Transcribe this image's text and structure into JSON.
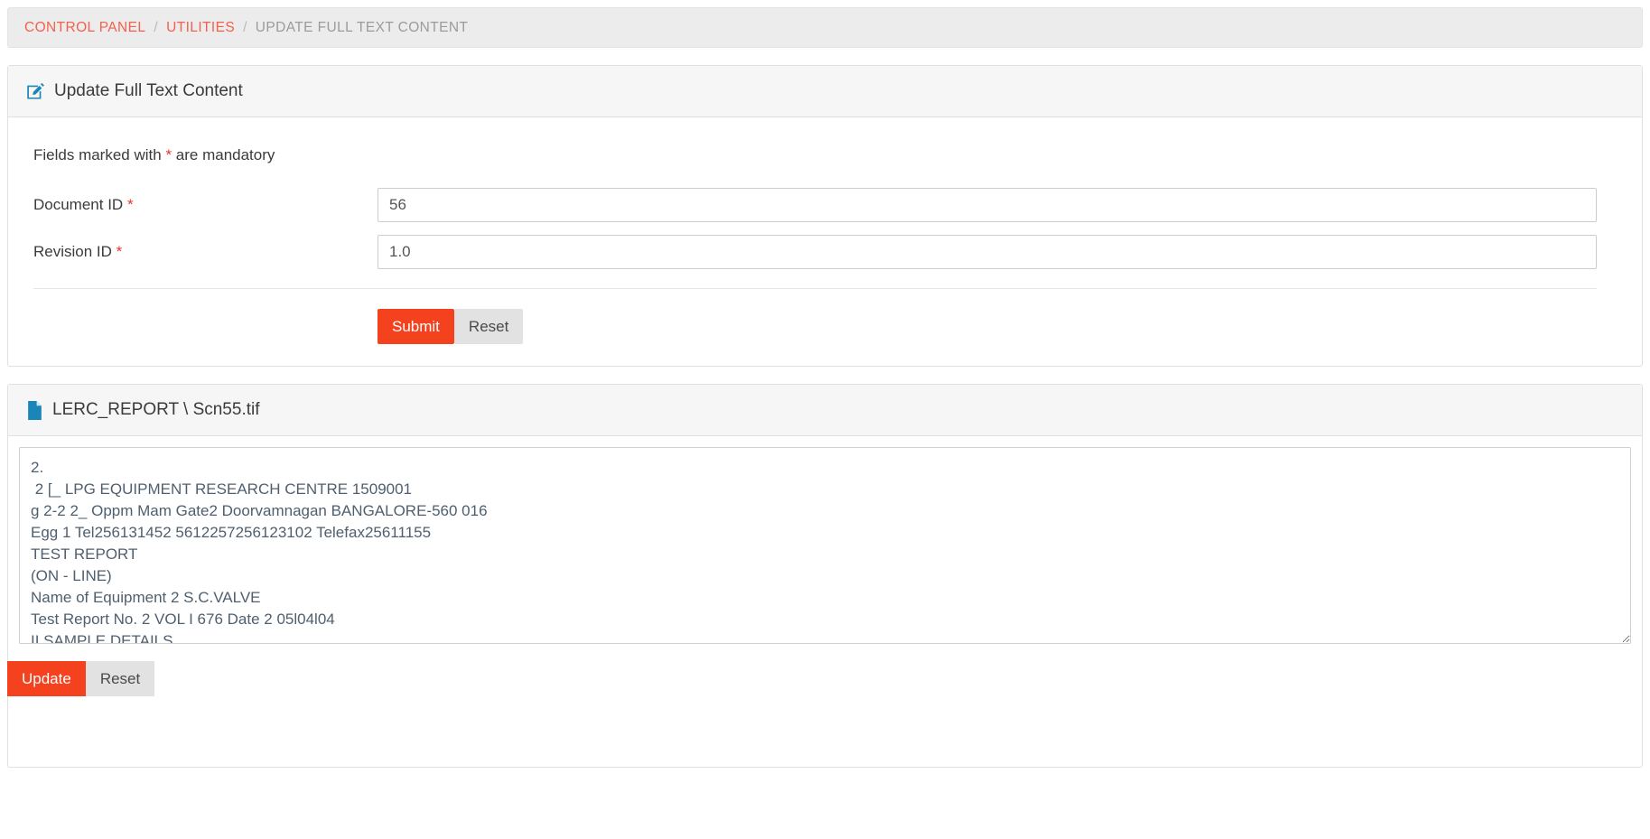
{
  "breadcrumb": {
    "items": [
      {
        "label": "CONTROL PANEL",
        "type": "link"
      },
      {
        "label": "UTILITIES",
        "type": "link"
      },
      {
        "label": "UPDATE FULL TEXT CONTENT",
        "type": "current"
      }
    ],
    "separator": "/"
  },
  "form_panel": {
    "icon": "edit-square-icon",
    "title": "Update Full Text Content",
    "mandatory_note_before": "Fields marked with ",
    "mandatory_marker": "*",
    "mandatory_note_after": " are mandatory",
    "fields": [
      {
        "label": "Document ID",
        "required_marker": "*",
        "value": "56",
        "placeholder": ""
      },
      {
        "label": "Revision ID",
        "required_marker": "*",
        "value": "1.0",
        "placeholder": ""
      }
    ],
    "submit_label": "Submit",
    "reset_label": "Reset"
  },
  "file_panel": {
    "icon": "file-icon",
    "title": "LERC_REPORT \\ Scn55.tif",
    "content": "2.\n 2 [_ LPG EQUIPMENT RESEARCH CENTRE 1509001\ng 2-2 2_ Oppm Mam Gate2 Doorvamnagan BANGALORE-560 016\nEgg 1 Tel256131452 5612257256123102 Telefax25611155\nTEST REPORT\n(ON - LINE)\nName of Equipment 2 S.C.VALVE\nTest Report No. 2 VOL I 676 Date 2 05l04l04\nII SAMPLE DETAILS",
    "update_label": "Update",
    "reset_label": "Reset"
  },
  "colors": {
    "accent_red": "#f4411e",
    "link_red": "#f4604c",
    "icon_blue": "#1a86b8",
    "required_red": "#e8342a",
    "breadcrumb_bg": "#ececec",
    "panel_heading_bg": "#f6f6f6"
  }
}
